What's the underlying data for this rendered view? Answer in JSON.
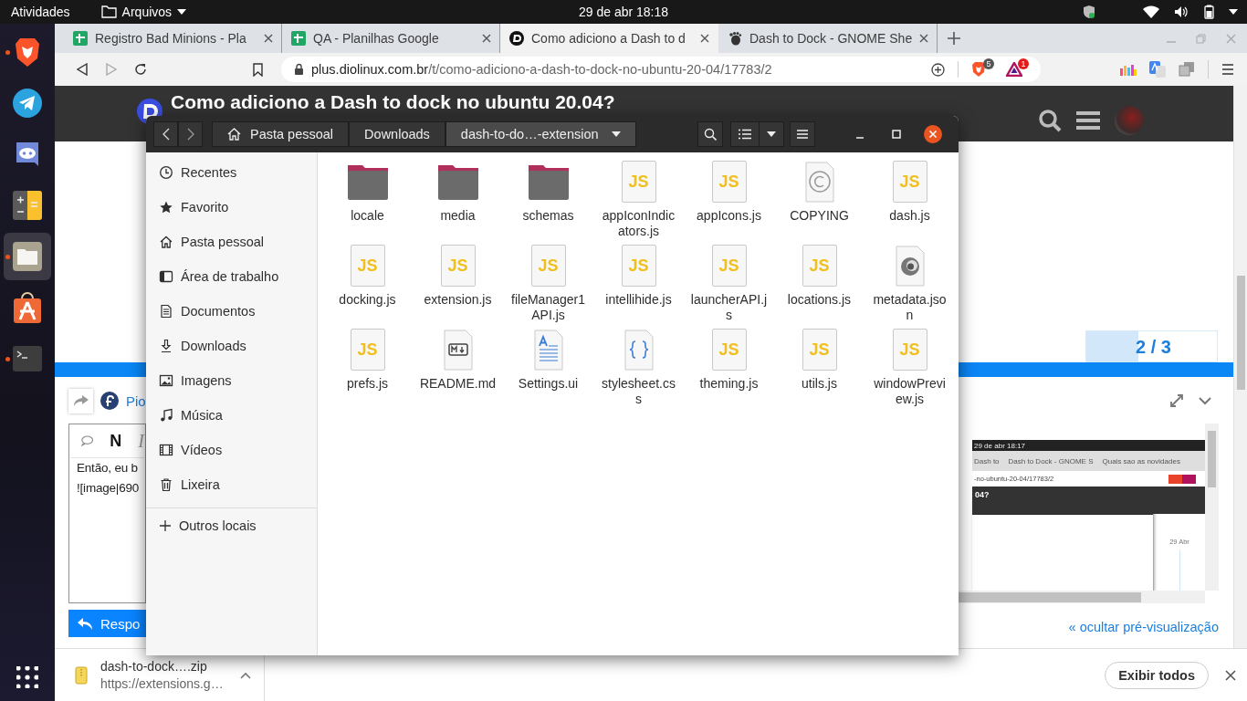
{
  "top_bar": {
    "activities": "Atividades",
    "app_menu": "Arquivos",
    "clock": "29 de abr  18:18"
  },
  "dock": {
    "apps": [
      {
        "kind": "brave",
        "running": true,
        "selected": false
      },
      {
        "kind": "telegram",
        "running": false,
        "selected": false
      },
      {
        "kind": "discord",
        "running": false,
        "selected": false
      },
      {
        "kind": "calculator",
        "running": false,
        "selected": false
      },
      {
        "kind": "files",
        "running": true,
        "selected": true
      },
      {
        "kind": "store",
        "running": false,
        "selected": false
      },
      {
        "kind": "terminal",
        "running": true,
        "selected": false
      }
    ]
  },
  "browser": {
    "tabs": [
      {
        "title": "Registro Bad Minions - Pla",
        "kind": "sheets",
        "selected": false
      },
      {
        "title": "QA - Planilhas Google",
        "kind": "sheets",
        "selected": false
      },
      {
        "title": "Como adiciono a Dash to d",
        "kind": "diolinux",
        "selected": true
      },
      {
        "title": "Dash to Dock - GNOME She",
        "kind": "gnome",
        "selected": false
      }
    ],
    "address": {
      "host": "plus.diolinux.com.br",
      "path": "/t/como-adiciono-a-dash-to-dock-no-ubuntu-20-04/17783/2"
    },
    "extension_badges": [
      "5",
      "1"
    ],
    "page": {
      "title": "Como adiciono a Dash to dock no ubuntu 20.04?",
      "timeline": {
        "position": "2 / 3",
        "level": 0.4
      },
      "composer": {
        "author": "Pio",
        "format_buttons": [
          "N",
          "I"
        ],
        "lines": [
          "Então, eu b",
          "![image|690"
        ],
        "reply_button": "Respo",
        "hide_preview": "« ocultar pré-visualização",
        "preview_screenshot": {
          "clock": "29 de abr  18:17",
          "tabs": [
            "Dash to",
            "Dash to Dock - GNOME S",
            "Quais sao as novidades"
          ],
          "url": "-no-ubuntu-20-04/17783/2",
          "heading": "04?",
          "date": "29 Abr"
        }
      }
    },
    "downloads": {
      "file": "dash-to-dock….zip",
      "source": "https://extensions.g…",
      "show_all": "Exibir todos"
    }
  },
  "file_manager": {
    "path": [
      {
        "label": "Pasta pessoal",
        "kind": "home",
        "selected": false
      },
      {
        "label": "Downloads",
        "kind": "plain",
        "selected": false
      },
      {
        "label": "dash-to-do…-extension",
        "kind": "menu",
        "selected": true
      }
    ],
    "sidebar": [
      {
        "label": "Recentes",
        "kind": "clock"
      },
      {
        "label": "Favorito",
        "kind": "star"
      },
      {
        "label": "Pasta pessoal",
        "kind": "home"
      },
      {
        "label": "Área de trabalho",
        "kind": "desktop"
      },
      {
        "label": "Documentos",
        "kind": "document"
      },
      {
        "label": "Downloads",
        "kind": "download"
      },
      {
        "label": "Imagens",
        "kind": "image"
      },
      {
        "label": "Música",
        "kind": "music"
      },
      {
        "label": "Vídeos",
        "kind": "film"
      },
      {
        "label": "Lixeira",
        "kind": "trash"
      }
    ],
    "other_locations": "Outros locais",
    "files": [
      {
        "name": "locale",
        "kind": "folder"
      },
      {
        "name": "media",
        "kind": "folder"
      },
      {
        "name": "schemas",
        "kind": "folder"
      },
      {
        "name": "appIconIndicators.js",
        "kind": "js",
        "badge": "JS"
      },
      {
        "name": "appIcons.js",
        "kind": "js",
        "badge": "JS"
      },
      {
        "name": "COPYING",
        "kind": "copyright"
      },
      {
        "name": "dash.js",
        "kind": "js",
        "badge": "JS"
      },
      {
        "name": "docking.js",
        "kind": "js",
        "badge": "JS"
      },
      {
        "name": "extension.js",
        "kind": "js",
        "badge": "JS"
      },
      {
        "name": "fileManager1API.js",
        "kind": "js",
        "badge": "JS"
      },
      {
        "name": "intellihide.js",
        "kind": "js",
        "badge": "JS"
      },
      {
        "name": "launcherAPI.js",
        "kind": "js",
        "badge": "JS"
      },
      {
        "name": "locations.js",
        "kind": "js",
        "badge": "JS"
      },
      {
        "name": "metadata.json",
        "kind": "json"
      },
      {
        "name": "prefs.js",
        "kind": "js",
        "badge": "JS"
      },
      {
        "name": "README.md",
        "kind": "markdown"
      },
      {
        "name": "Settings.ui",
        "kind": "ui"
      },
      {
        "name": "stylesheet.css",
        "kind": "css"
      },
      {
        "name": "theming.js",
        "kind": "js",
        "badge": "JS"
      },
      {
        "name": "utils.js",
        "kind": "js",
        "badge": "JS"
      },
      {
        "name": "windowPreview.js",
        "kind": "js",
        "badge": "JS"
      }
    ]
  }
}
